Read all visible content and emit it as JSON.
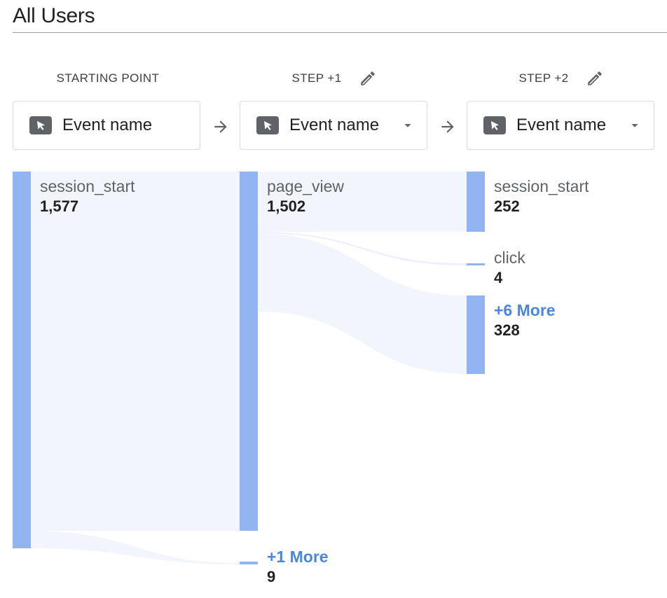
{
  "segment": {
    "title": "All Users"
  },
  "columns": [
    {
      "header": "STARTING POINT",
      "dimension": "Event name",
      "editable": false,
      "has_dropdown": false
    },
    {
      "header": "STEP +1",
      "dimension": "Event name",
      "editable": true,
      "has_dropdown": true
    },
    {
      "header": "STEP +2",
      "dimension": "Event name",
      "editable": true,
      "has_dropdown": true
    }
  ],
  "nodes": {
    "start_session_start": {
      "label": "session_start",
      "value": "1,577"
    },
    "step1_page_view": {
      "label": "page_view",
      "value": "1,502"
    },
    "step1_more": {
      "label": "+1 More",
      "value": "9"
    },
    "step2_session_start": {
      "label": "session_start",
      "value": "252"
    },
    "step2_click": {
      "label": "click",
      "value": "4"
    },
    "step2_more": {
      "label": "+6 More",
      "value": "328"
    }
  },
  "icons": {
    "dimension": "cursor-click-icon",
    "edit": "pencil-icon",
    "arrow": "arrow-right-icon",
    "dropdown": "chevron-down-icon"
  },
  "colors": {
    "node_bar": "#93b4f2",
    "flow_fill": "#f3f5fd",
    "more_link": "#4a86e0"
  }
}
